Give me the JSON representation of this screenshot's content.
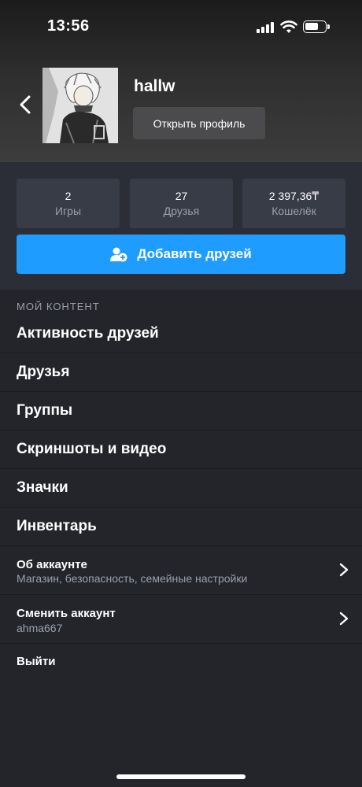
{
  "status_bar": {
    "time": "13:56"
  },
  "profile": {
    "username": "hallw",
    "open_profile_label": "Открыть профиль"
  },
  "stats": [
    {
      "value": "2",
      "label": "Игры"
    },
    {
      "value": "27",
      "label": "Друзья"
    },
    {
      "value": "2 397,36₸",
      "label": "Кошелёк"
    }
  ],
  "add_friends_label": "Добавить друзей",
  "section_title": "МОЙ КОНТЕНТ",
  "menu": [
    {
      "label": "Активность друзей"
    },
    {
      "label": "Друзья"
    },
    {
      "label": "Группы"
    },
    {
      "label": "Скриншоты и видео"
    },
    {
      "label": "Значки"
    },
    {
      "label": "Инвентарь"
    }
  ],
  "account": {
    "title": "Об аккаунте",
    "subtitle": "Магазин, безопасность, семейные настройки"
  },
  "switch_account": {
    "title": "Сменить аккаунт",
    "subtitle": "ahma667"
  },
  "logout_label": "Выйти",
  "colors": {
    "accent": "#1f9cff",
    "background": "#23252b",
    "panel": "#2b2e37",
    "tile": "#383c47"
  }
}
